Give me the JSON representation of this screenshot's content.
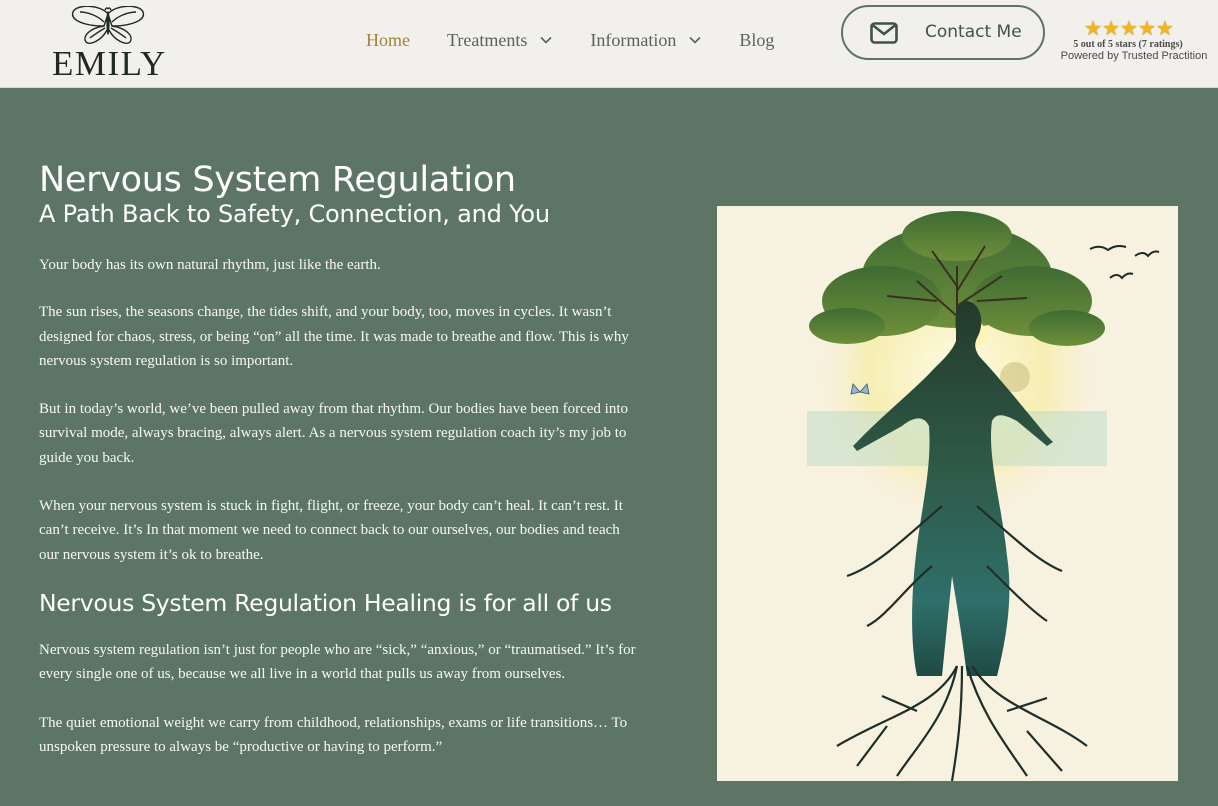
{
  "header": {
    "logo_text": "EMILY",
    "nav": [
      {
        "label": "Home",
        "dropdown": false,
        "active": true
      },
      {
        "label": "Treatments",
        "dropdown": true
      },
      {
        "label": "Information",
        "dropdown": true
      },
      {
        "label": "Blog",
        "dropdown": false
      }
    ],
    "contact_label": "Contact Me",
    "rating": {
      "stars": 5,
      "summary": "5 out of 5 stars (7 ratings)",
      "powered_by": "Powered by Trusted Practition"
    }
  },
  "main": {
    "title": "Nervous System Regulation",
    "subtitle": "A Path Back to Safety, Connection, and You",
    "paragraphs_1": [
      "Your body has its own natural rhythm, just like the earth.",
      "The sun rises, the seasons change, the tides shift, and your body, too, moves in cycles. It wasn’t designed for chaos, stress, or being “on” all the time. It was made to breathe and flow. This is why nervous system regulation is so important.",
      "But in today’s world, we’ve been pulled away from that rhythm. Our bodies have been forced into survival mode, always bracing, always alert. As a nervous system regulation coach ity’s my job to guide you back.",
      "When your nervous system is stuck in fight, flight, or freeze, your body can’t heal. It can’t rest. It can’t receive. It’s In that moment we need to connect back to our ourselves, our bodies and teach our nervous system it’s ok to breathe."
    ],
    "section_heading": "Nervous System Regulation Healing is for all of us",
    "paragraphs_2": [
      "Nervous system regulation isn’t just for people who are “sick,” “anxious,” or “traumatised.” It’s for every single one of us, because we all live in a world that pulls us away from ourselves.",
      "The quiet emotional weight we carry from childhood, relationships, exams or life transitions… To unspoken pressure to always be “productive or having to perform.”"
    ]
  },
  "colors": {
    "background": "#5d7565",
    "header_bg": "#f2f0ec",
    "nav_active": "#a2833a",
    "nav_text": "#56645c",
    "star": "#f3b521"
  },
  "icons": {
    "logo": "butterfly-icon",
    "dropdown": "chevron-down-icon",
    "contact": "envelope-icon",
    "rating": "star-icon"
  }
}
